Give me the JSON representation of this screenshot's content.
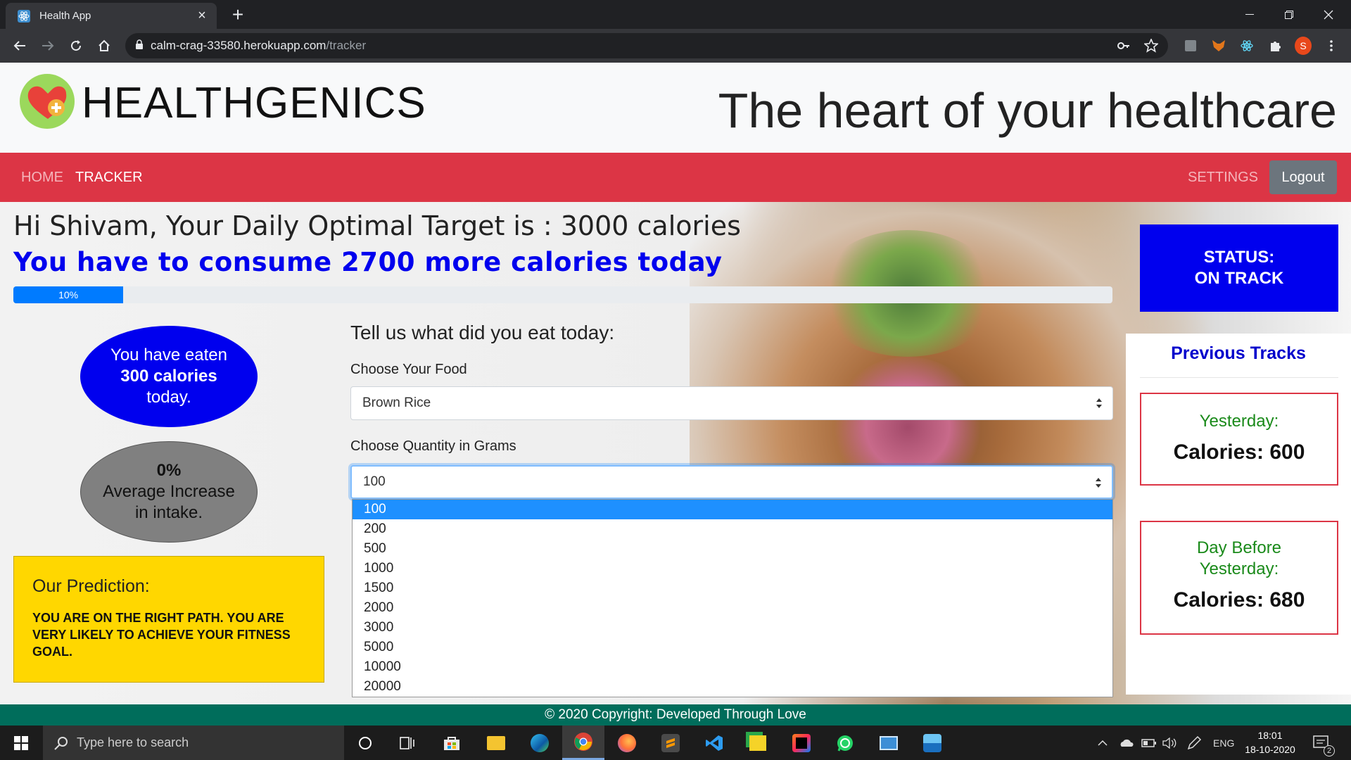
{
  "browser": {
    "tab_title": "Health App",
    "url_host": "calm-crag-33580.herokuapp.com",
    "url_path": "/tracker",
    "profile_initial": "S"
  },
  "site": {
    "brand": "HEALTHGENICS",
    "tagline": "The heart of your healthcare"
  },
  "nav": {
    "home": "HOME",
    "tracker": "TRACKER",
    "settings": "SETTINGS",
    "logout": "Logout"
  },
  "tracker": {
    "greeting": "Hi Shivam, Your Daily Optimal Target is : 3000 calories",
    "consume_message": "You have to consume 2700 more calories today",
    "progress_label": "10%",
    "progress_value": 10,
    "status_line1": "STATUS:",
    "status_line2": "ON TRACK",
    "eaten_line1": "You have eaten",
    "eaten_line2": "300 calories",
    "eaten_line3": "today.",
    "avg_line1": "0%",
    "avg_line2": "Average Increase",
    "avg_line3": "in intake.",
    "prediction_title": "Our Prediction:",
    "prediction_text": "YOU ARE ON THE RIGHT PATH. YOU ARE VERY LIKELY TO ACHIEVE YOUR FITNESS GOAL."
  },
  "form": {
    "title": "Tell us what did you eat today:",
    "food_label": "Choose Your Food",
    "food_value": "Brown Rice",
    "quantity_label": "Choose Quantity in Grams",
    "quantity_value": "100",
    "quantity_options": [
      "100",
      "200",
      "500",
      "1000",
      "1500",
      "2000",
      "3000",
      "5000",
      "10000",
      "20000"
    ]
  },
  "previous": {
    "title": "Previous Tracks",
    "yesterday_label": "Yesterday:",
    "yesterday_calories": "Calories: 600",
    "daybefore_label1": "Day Before",
    "daybefore_label2": "Yesterday:",
    "daybefore_calories": "Calories: 680"
  },
  "footer": {
    "text": "© 2020 Copyright: Developed Through Love"
  },
  "taskbar": {
    "search_placeholder": "Type here to search",
    "lang": "ENG",
    "time": "18:01",
    "date": "18-10-2020",
    "notification_count": "2"
  },
  "colors": {
    "navbar": "#dc3545",
    "status_blue": "#0000ee",
    "prediction_yellow": "#ffd700",
    "footer": "#006d5b"
  }
}
